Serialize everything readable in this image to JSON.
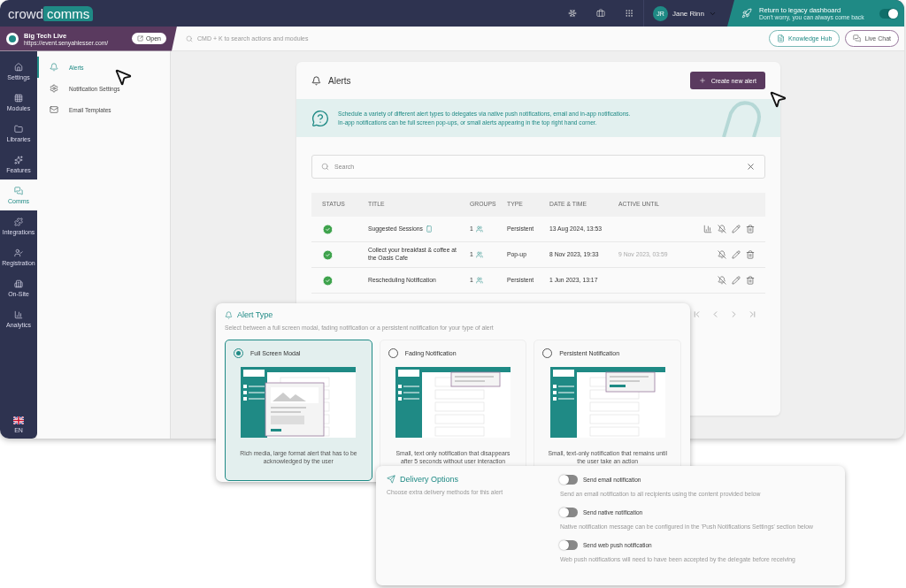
{
  "topbar": {
    "logo_left": "crowd",
    "logo_right": "comms",
    "user": {
      "initials": "JR",
      "name": "Jane Rinn"
    },
    "legacy": {
      "title": "Return to legacy dashboard",
      "subtitle": "Don't worry, you can always come back",
      "on": true
    }
  },
  "event": {
    "name": "Big Tech Live",
    "url": "https://event.senyahlesser.com/",
    "open_label": "Open"
  },
  "search_placeholder": "CMD + K to search actions and modules",
  "help_buttons": [
    {
      "label": "Knowledge Hub",
      "kind": "doc"
    },
    {
      "label": "Live Chat",
      "kind": "chat"
    }
  ],
  "rail": [
    {
      "label": "Settings",
      "selected": false
    },
    {
      "label": "Modules",
      "selected": false
    },
    {
      "label": "Libraries",
      "selected": false
    },
    {
      "label": "Features",
      "selected": false
    },
    {
      "label": "Comms",
      "selected": true
    },
    {
      "label": "Integrations",
      "selected": false
    },
    {
      "label": "Registration",
      "selected": false
    },
    {
      "label": "On-Site",
      "selected": false
    },
    {
      "label": "Analytics",
      "selected": false
    }
  ],
  "language": "EN",
  "submenu": [
    {
      "label": "Alerts",
      "selected": true
    },
    {
      "label": "Notification Settings",
      "selected": false
    },
    {
      "label": "Email Templates",
      "selected": false
    }
  ],
  "alerts": {
    "title": "Alerts",
    "create_label": "Create new alert",
    "info": [
      "Schedule a variety of different alert types to delegates via native push notifications, email and in-app notifications.",
      "In-app notifications can be full screen pop-ups, or small alerts appearing in the top right hand corner."
    ],
    "search_placeholder": "Search",
    "columns": [
      "STATUS",
      "TITLE",
      "GROUPS",
      "TYPE",
      "DATE & TIME",
      "ACTIVE UNTIL"
    ],
    "rows": [
      {
        "active": true,
        "title": "Suggested Sessions",
        "mobile": true,
        "groups": "1",
        "type": "Persistent",
        "date": "13 Aug 2024, 13:53",
        "analytics": true
      },
      {
        "active": true,
        "title": "Collect your breakfast & coffee at the Oasis Cafe",
        "mobile": false,
        "groups": "1",
        "type": "Pop-up",
        "date": "8 Nov 2023, 19:33",
        "active_until": "9 Nov 2023, 03:59",
        "analytics": false
      },
      {
        "active": true,
        "title": "Rescheduling Notification",
        "mobile": false,
        "groups": "1",
        "type": "Persistent",
        "date": "1 Jun 2023, 13:17",
        "analytics": false
      }
    ]
  },
  "alert_type": {
    "title": "Alert Type",
    "subtitle": "Select between a full screen modal, fading notification or a persistent notification for your type of alert",
    "options": [
      {
        "label": "Full Screen Modal",
        "kind": "modal",
        "selected": true,
        "description": "Rich media, large format alert that has to be acknowledged by the user"
      },
      {
        "label": "Fading Notification",
        "kind": "fading",
        "selected": false,
        "description": "Small, text only notification that disappears after 5 seconds without user interaction"
      },
      {
        "label": "Persistent Notification",
        "kind": "persistent",
        "selected": false,
        "description": "Small, text-only notification that remains until the user take an action"
      }
    ]
  },
  "delivery": {
    "title": "Delivery Options",
    "subtitle": "Choose extra delivery methods for this alert",
    "options": [
      {
        "label": "Send email notification",
        "on": false,
        "description": "Send an email notification to all recipients using the content provided below"
      },
      {
        "label": "Send native notification",
        "on": false,
        "description": "Native notification message can be configured in the 'Push Notifications Settings' section below"
      },
      {
        "label": "Send web push notification",
        "on": false,
        "description": "Web push notifications will need to have been accepted by the delegate before receiving"
      }
    ]
  }
}
